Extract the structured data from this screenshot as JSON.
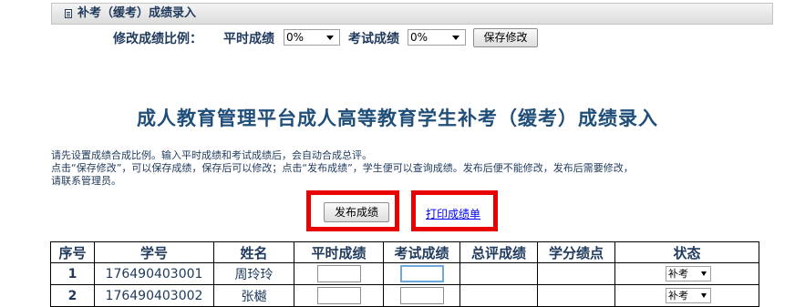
{
  "panel": {
    "title": "补考（缓考）成绩录入"
  },
  "ratio": {
    "label": "修改成绩比例：",
    "usual_label": "平时成绩",
    "usual_value": "0%",
    "exam_label": "考试成绩",
    "exam_value": "0%",
    "save_button": "保存修改"
  },
  "heading": "成人教育管理平台成人高等教育学生补考（缓考）成绩录入",
  "instructions": [
    "请先设置成绩合成比例。输入平时成绩和考试成绩后，会自动合成总评。",
    "点击“保存修改”，可以保存成绩，保存后可以修改；点击“发布成绩”，学生便可以查询成绩。发布后便不能修改，发布后需要修改，",
    "请联系管理员。"
  ],
  "actions": {
    "publish_button": "发布成绩",
    "print_link": "打印成绩单"
  },
  "table": {
    "headers": [
      "序号",
      "学号",
      "姓名",
      "平时成绩",
      "考试成绩",
      "总评成绩",
      "学分绩点",
      "状态"
    ],
    "rows": [
      {
        "no": "1",
        "id": "176490403001",
        "name": "周玲玲",
        "status": "补考"
      },
      {
        "no": "2",
        "id": "176490403002",
        "name": "张樾",
        "status": "补考"
      }
    ]
  },
  "colors": {
    "highlight": "#e60000",
    "text": "#1f3a5c",
    "heading": "#1f4e79",
    "link": "#0000ee"
  },
  "icons": {
    "title_icon": "document-icon",
    "dropdown": "chevron-down-icon"
  }
}
